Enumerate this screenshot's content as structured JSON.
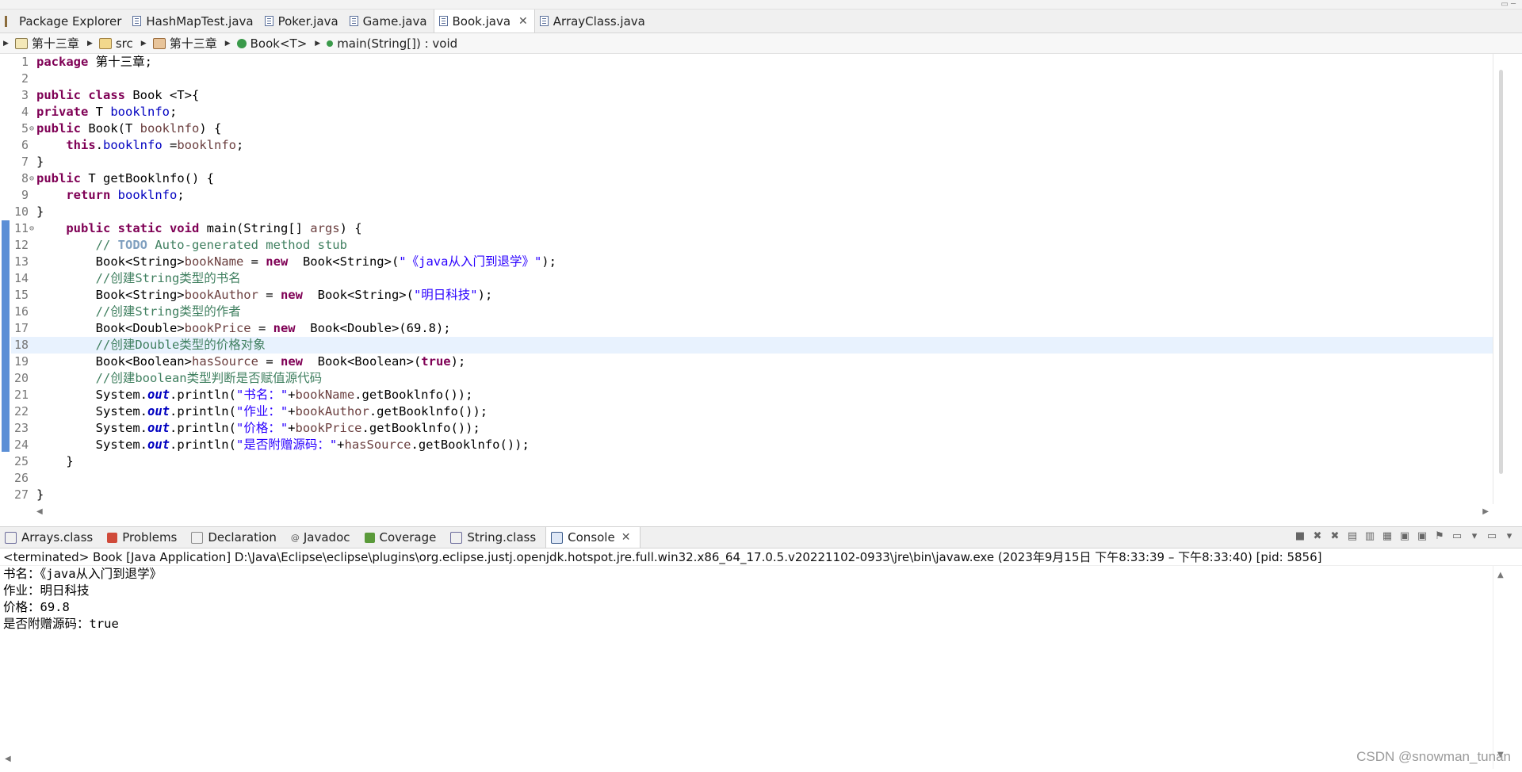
{
  "window": {
    "minmax": "▭ ─"
  },
  "editor_tabs": [
    {
      "label": "Package Explorer",
      "icon": "package-explorer-icon",
      "active": false
    },
    {
      "label": "HashMapTest.java",
      "icon": "java-file-icon",
      "active": false
    },
    {
      "label": "Poker.java",
      "icon": "java-file-icon",
      "active": false
    },
    {
      "label": "Game.java",
      "icon": "java-file-icon",
      "active": false
    },
    {
      "label": "Book.java",
      "icon": "java-file-icon",
      "active": true,
      "close": "✕"
    },
    {
      "label": "ArrayClass.java",
      "icon": "java-file-icon",
      "active": false
    }
  ],
  "breadcrumb": [
    {
      "label": "第十三章",
      "icon": "project-icon"
    },
    {
      "label": "src",
      "icon": "source-folder-icon"
    },
    {
      "label": "第十三章",
      "icon": "package-icon"
    },
    {
      "label": "Book<T>",
      "icon": "class-icon"
    },
    {
      "label": "main(String[]) : void",
      "icon": "method-icon"
    }
  ],
  "code_lines": [
    "1",
    "2",
    "3",
    "4",
    "5",
    "6",
    "7",
    "8",
    "9",
    "10",
    "11",
    "12",
    "13",
    "14",
    "15",
    "16",
    "17",
    "18",
    "19",
    "20",
    "21",
    "22",
    "23",
    "24",
    "25",
    "26",
    "27"
  ],
  "code": {
    "l1_kw": "package",
    "l1_rest": " 第十三章;",
    "l3_kw": "public class",
    "l3_rest": " Book <T>{",
    "l4_kw": "private",
    "l4_t": " T ",
    "l4_f": "booklnfo",
    "l4_end": ";",
    "l5_kw": "public",
    "l5_a": " Book(T ",
    "l5_p": "booklnfo",
    "l5_b": ") {",
    "l6_kw": "this",
    "l6_dot": ".",
    "l6_f": "booklnfo",
    "l6_eq": " =",
    "l6_p": "booklnfo",
    "l6_end": ";",
    "l7": "}",
    "l8_kw": "public",
    "l8_rest": " T getBooklnfo() {",
    "l9_kw": "return",
    "l9_f": "booklnfo",
    "l9_end": ";",
    "l10": "}",
    "l11_kw": "public static void",
    "l11_a": " main(String[] ",
    "l11_p": "args",
    "l11_b": ") {",
    "l12_c1": "// ",
    "l12_todo": "TODO",
    "l12_c2": " Auto-generated method stub",
    "l13_a": "Book<String>",
    "l13_v": "bookName",
    "l13_eq": " = ",
    "l13_kw": "new",
    "l13_b": "  Book<String>(",
    "l13_s": "\"《java从入门到退学》\"",
    "l13_end": ");",
    "l14": "//创建String类型的书名",
    "l15_a": "Book<String>",
    "l15_v": "bookAuthor",
    "l15_eq": " = ",
    "l15_kw": "new",
    "l15_b": "  Book<String>(",
    "l15_s": "\"明日科技\"",
    "l15_end": ");",
    "l16": "//创建String类型的作者",
    "l17_a": "Book<Double>",
    "l17_v": "bookPrice",
    "l17_eq": " = ",
    "l17_kw": "new",
    "l17_b": "  Book<Double>(69.8);",
    "l18": "//创建Double类型的价格对象",
    "l19_a": "Book<Boolean>",
    "l19_v": "hasSource",
    "l19_eq": " = ",
    "l19_kw": "new",
    "l19_b": "  Book<Boolean>(",
    "l19_kw2": "true",
    "l19_end": ");",
    "l20": "//创建boolean类型判断是否赋值源代码",
    "l21_a": "System.",
    "l21_o": "out",
    "l21_b": ".println(",
    "l21_s": "\"书名：\"",
    "l21_c": "+",
    "l21_v": "bookName",
    "l21_d": ".getBooklnfo());",
    "l22_a": "System.",
    "l22_o": "out",
    "l22_b": ".println(",
    "l22_s": "\"作业：\"",
    "l22_c": "+",
    "l22_v": "bookAuthor",
    "l22_d": ".getBooklnfo());",
    "l23_a": "System.",
    "l23_o": "out",
    "l23_b": ".println(",
    "l23_s": "\"价格：\"",
    "l23_c": "+",
    "l23_v": "bookPrice",
    "l23_d": ".getBooklnfo());",
    "l24_a": "System.",
    "l24_o": "out",
    "l24_b": ".println(",
    "l24_s": "\"是否附赠源码：\"",
    "l24_c": "+",
    "l24_v": "hasSource",
    "l24_d": ".getBooklnfo());",
    "l25": "}",
    "l27": "}"
  },
  "view_tabs": [
    {
      "label": "Arrays.class",
      "icon": "class-file-icon",
      "active": false
    },
    {
      "label": "Problems",
      "icon": "problems-icon",
      "active": false
    },
    {
      "label": "Declaration",
      "icon": "declaration-icon",
      "active": false
    },
    {
      "label": "Javadoc",
      "icon": "javadoc-icon",
      "active": false
    },
    {
      "label": "Coverage",
      "icon": "coverage-icon",
      "active": false
    },
    {
      "label": "String.class",
      "icon": "class-file-icon",
      "active": false
    },
    {
      "label": "Console",
      "icon": "console-icon",
      "active": true,
      "close": "✕"
    }
  ],
  "console": {
    "header": "<terminated> Book [Java Application] D:\\Java\\Eclipse\\eclipse\\plugins\\org.eclipse.justj.openjdk.hotspot.jre.full.win32.x86_64_17.0.5.v20221102-0933\\jre\\bin\\javaw.exe  (2023年9月15日 下午8:33:39 – 下午8:33:40) [pid: 5856]",
    "output": [
      "书名：《java从入门到退学》",
      "作业：明日科技",
      "价格：69.8",
      "是否附赠源码：true"
    ]
  },
  "watermark": "CSDN @snowman_tunan",
  "colors": {
    "keyword": "#7f0055",
    "field": "#0000c0",
    "string": "#2a00ff",
    "comment": "#3f7f5f",
    "current_line": "#e8f2fe"
  }
}
